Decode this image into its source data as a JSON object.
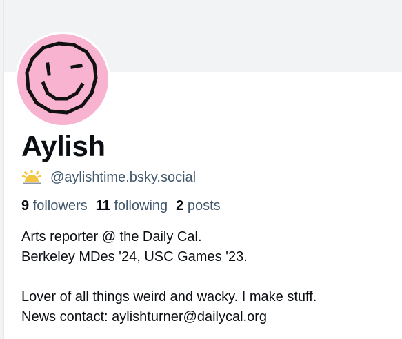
{
  "profile": {
    "display_name": "Aylish",
    "handle": "@aylishtime.bsky.social",
    "handle_badge_icon": "sun-icon",
    "avatar_icon": "smiley-face-icon",
    "colors": {
      "avatar_bg": "#f7b3cf",
      "banner_bg": "#f1f3f5",
      "muted_text": "#42576c",
      "badge_yellow": "#f5c542"
    }
  },
  "stats": {
    "followers_count": "9",
    "followers_label": "followers",
    "following_count": "11",
    "following_label": "following",
    "posts_count": "2",
    "posts_label": "posts"
  },
  "bio": {
    "line1": "Arts reporter @ the Daily Cal.",
    "line2": "Berkeley MDes '24, USC Games '23.",
    "line3": "",
    "line4": "Lover of all things weird and wacky. I make stuff.",
    "line5_prefix": "News contact: ",
    "email": "aylishturner@dailycal.org"
  }
}
